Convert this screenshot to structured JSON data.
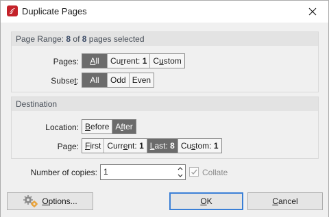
{
  "window": {
    "title": "Duplicate Pages",
    "icons": {
      "app": "pdf-app-icon",
      "close": "close-icon"
    }
  },
  "page_range": {
    "prefix": "Page Range: ",
    "selected": "8",
    "of": " of ",
    "total": "8",
    "suffix": " pages selected",
    "pages_label": "Pages:",
    "pages_options": [
      {
        "pre": "",
        "key": "A",
        "post": "ll",
        "value": "",
        "selected": true
      },
      {
        "pre": "Cu",
        "key": "r",
        "post": "rent: ",
        "value": "1",
        "selected": false
      },
      {
        "pre": "C",
        "key": "u",
        "post": "stom",
        "value": "",
        "selected": false
      }
    ],
    "subset_label_pre": "Subse",
    "subset_label_key": "t",
    "subset_label_post": ":",
    "subset_options": [
      {
        "label": "All",
        "selected": true
      },
      {
        "label": "Odd",
        "selected": false
      },
      {
        "label": "Even",
        "selected": false
      }
    ]
  },
  "destination": {
    "heading": "Destination",
    "location_label": "Location:",
    "location_options": [
      {
        "pre": "",
        "key": "B",
        "post": "efore",
        "selected": false
      },
      {
        "pre": "A",
        "key": "f",
        "post": "ter",
        "selected": true
      }
    ],
    "page_label": "Page:",
    "page_options": [
      {
        "pre": "",
        "key": "F",
        "post": "irst",
        "value": "",
        "selected": false
      },
      {
        "pre": "Curr",
        "key": "e",
        "post": "nt: ",
        "value": "1",
        "selected": false
      },
      {
        "pre": "",
        "key": "L",
        "post": "ast: ",
        "value": "8",
        "selected": true
      },
      {
        "pre": "Cu",
        "key": "s",
        "post": "tom: ",
        "value": "1",
        "selected": false
      }
    ]
  },
  "copies": {
    "label": "Number of copies:",
    "value": "1",
    "collate_label": "Collate",
    "collate_checked": true
  },
  "buttons": {
    "options_pre": "",
    "options_key": "O",
    "options_post": "ptions...",
    "ok_pre": "",
    "ok_key": "O",
    "ok_post": "K",
    "cancel_pre": "",
    "cancel_key": "C",
    "cancel_post": "ancel",
    "options_icon": "gears-icon"
  },
  "colors": {
    "selected_segment": "#6b6b6b",
    "app_icon": "#c4222a",
    "default_button_border": "#3a7fd6"
  }
}
